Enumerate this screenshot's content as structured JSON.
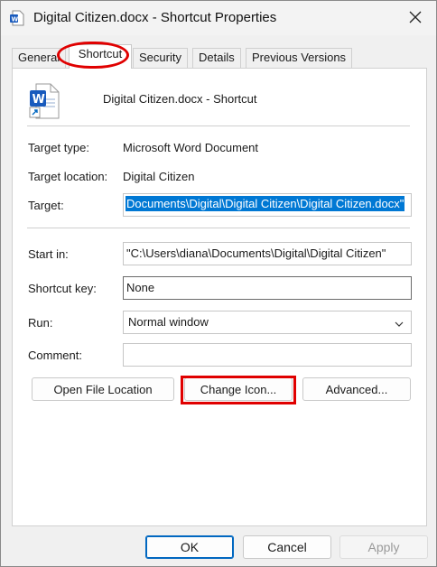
{
  "window": {
    "title": "Digital Citizen.docx - Shortcut Properties"
  },
  "tabs": [
    {
      "label": "General"
    },
    {
      "label": "Shortcut"
    },
    {
      "label": "Security"
    },
    {
      "label": "Details"
    },
    {
      "label": "Previous Versions"
    }
  ],
  "header": {
    "shortcut_name": "Digital Citizen.docx - Shortcut"
  },
  "properties": {
    "target_type_label": "Target type:",
    "target_type_value": "Microsoft Word Document",
    "target_location_label": "Target location:",
    "target_location_value": "Digital Citizen",
    "target_label": "Target:",
    "target_value": "Documents\\Digital\\Digital Citizen\\Digital Citizen.docx\"",
    "start_in_label": "Start in:",
    "start_in_value": "\"C:\\Users\\diana\\Documents\\Digital\\Digital Citizen\"",
    "shortcut_key_label": "Shortcut key:",
    "shortcut_key_value": "None",
    "run_label": "Run:",
    "run_value": "Normal window",
    "comment_label": "Comment:",
    "comment_value": ""
  },
  "actions": {
    "open_file_location": "Open File Location",
    "change_icon": "Change Icon...",
    "advanced": "Advanced..."
  },
  "footer": {
    "ok": "OK",
    "cancel": "Cancel",
    "apply": "Apply"
  },
  "colors": {
    "highlight_red": "#e00000",
    "selection_blue": "#0078d4",
    "word_blue": "#185abd"
  }
}
